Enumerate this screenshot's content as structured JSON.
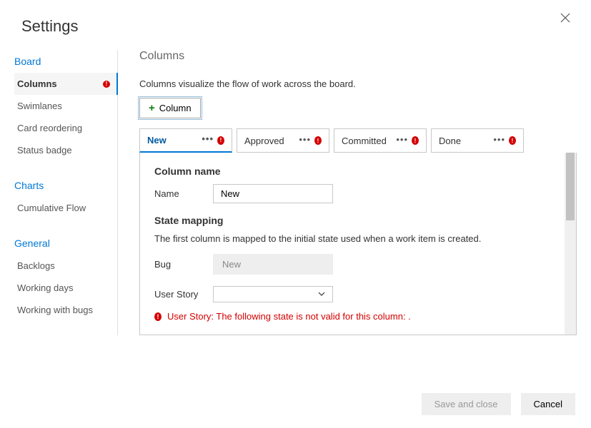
{
  "title": "Settings",
  "sidebar": {
    "board": {
      "heading": "Board",
      "items": [
        {
          "label": "Columns",
          "active": true,
          "error": true
        },
        {
          "label": "Swimlanes"
        },
        {
          "label": "Card reordering"
        },
        {
          "label": "Status badge"
        }
      ]
    },
    "charts": {
      "heading": "Charts",
      "items": [
        {
          "label": "Cumulative Flow"
        }
      ]
    },
    "general": {
      "heading": "General",
      "items": [
        {
          "label": "Backlogs"
        },
        {
          "label": "Working days"
        },
        {
          "label": "Working with bugs"
        }
      ]
    }
  },
  "main": {
    "heading": "Columns",
    "description": "Columns visualize the flow of work across the board.",
    "add_button_label": "Column",
    "tabs": [
      {
        "label": "New",
        "active": true,
        "error": true
      },
      {
        "label": "Approved",
        "error": true
      },
      {
        "label": "Committed",
        "error": true
      },
      {
        "label": "Done",
        "error": true
      }
    ],
    "column_name_section": "Column name",
    "name_label": "Name",
    "name_value": "New",
    "state_mapping_section": "State mapping",
    "state_mapping_desc": "The first column is mapped to the initial state used when a work item is created.",
    "bug_label": "Bug",
    "bug_value": "New",
    "user_story_label": "User Story",
    "user_story_value": "",
    "error_message": "User Story: The following state is not valid for this column: ."
  },
  "footer": {
    "save_label": "Save and close",
    "cancel_label": "Cancel"
  }
}
